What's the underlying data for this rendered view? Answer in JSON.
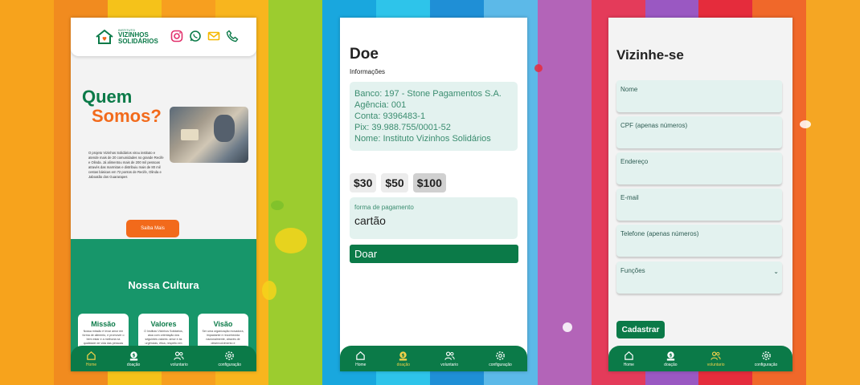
{
  "colors": {
    "brand_green": "#0b7a48",
    "brand_orange": "#f26a1b",
    "teal_section": "#17966a",
    "field_bg": "#e3f2ef"
  },
  "home": {
    "logo": {
      "small": "INSTITUTO",
      "line1": "VIZINHOS",
      "line2": "SOLIDÁRIOS"
    },
    "socials": [
      "instagram-icon",
      "whatsapp-icon",
      "mail-icon",
      "phone-icon"
    ],
    "title_line1": "Quem",
    "title_line2": "Somos?",
    "about": "O projeto Vizinhos Solidários virou instituto e atende mais de 20 comunidades no grande Recife e Olinda. Já alimentou mais de 200 mil pessoas através das marmitas e distribuiu mais de 80 mil cestas básicas em 72 pontos de Recife, Olinda e Jaboatão dos Guararapes",
    "cta": "Saiba Mais",
    "culture_title": "Nossa Cultura",
    "cards": [
      {
        "title": "Missão",
        "text": "Nossa missão é levar amor em forma de alimento, e promover o bem estar e a melhoria na qualidade de vida das pessoas que"
      },
      {
        "title": "Valores",
        "text": "O Instituto Vizinhos Solidários, atua com orientação dos seguintes valores: amor e às urgências, ética, respeito em equipe,"
      },
      {
        "title": "Visão",
        "text": "Ser uma organização inovadora, impactante e reconhecida nacionalmente, através de desenvolvimento e implementação de soluções e melhorias sociais das famílias carentes que"
      }
    ]
  },
  "nav": [
    {
      "label": "Home",
      "icon": "home-icon"
    },
    {
      "label": "doação",
      "icon": "donation-icon"
    },
    {
      "label": "voluntario",
      "icon": "volunteer-icon"
    },
    {
      "label": "configuração",
      "icon": "gear-icon"
    }
  ],
  "donate": {
    "title": "Doe",
    "info_label": "Informações",
    "bank_lines": [
      "Banco: 197 - Stone Pagamentos S.A.",
      "Agência: 001",
      "Conta: 9396483-1",
      "Pix: 39.988.755/0001-52",
      "Nome: Instituto Vizinhos Solidários"
    ],
    "amounts": [
      "$30",
      "$50",
      "$100"
    ],
    "selected_amount": "$100",
    "payment_label": "forma de pagamento",
    "payment_value": "cartão",
    "submit": "Doar"
  },
  "volunteer": {
    "title": "Vizinhe-se",
    "fields": [
      "Nome",
      "CPF (apenas números)",
      "Endereço",
      "E-mail",
      "Telefone (apenas números)",
      "Funções"
    ],
    "submit": "Cadastrar"
  }
}
